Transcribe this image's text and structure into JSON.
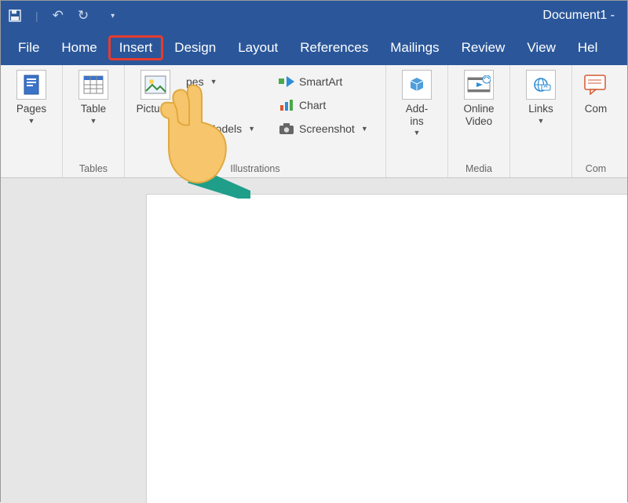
{
  "title": "Document1  -",
  "qat": {
    "save": "save-icon",
    "undo": "↶",
    "redo": "↻",
    "custom": "▾"
  },
  "tabs": [
    "File",
    "Home",
    "Insert",
    "Design",
    "Layout",
    "References",
    "Mailings",
    "Review",
    "View",
    "Hel"
  ],
  "highlighted_tab": "Insert",
  "groups": {
    "pages": {
      "button": "Pages",
      "label": ""
    },
    "tables": {
      "button": "Table",
      "label": "Tables"
    },
    "illustrations": {
      "pictures": "Pictures",
      "shapes": "pes",
      "models": "Models",
      "smartart": "SmartArt",
      "chart": "Chart",
      "screenshot": "Screenshot",
      "label": "Illustrations"
    },
    "addins": {
      "button": "Add-\nins",
      "label": ""
    },
    "media": {
      "button": "Online\nVideo",
      "label": "Media"
    },
    "links": {
      "button": "Links",
      "label": ""
    },
    "comments": {
      "button": "Com",
      "label": "Com"
    }
  }
}
